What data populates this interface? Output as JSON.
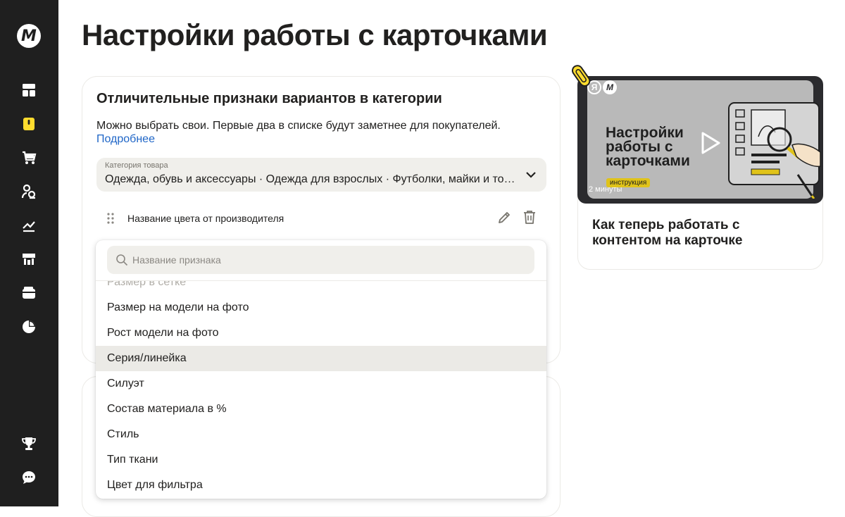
{
  "sidebar": {
    "logo_letter": "M",
    "items": [
      {
        "icon": "dashboard-icon"
      },
      {
        "icon": "card-icon",
        "active": true
      },
      {
        "icon": "cart-icon"
      },
      {
        "icon": "users-icon"
      },
      {
        "icon": "growth-icon"
      },
      {
        "icon": "store-icon"
      },
      {
        "icon": "wallet-icon"
      },
      {
        "icon": "pie-chart-icon"
      },
      {
        "icon": "trophy-icon"
      },
      {
        "icon": "chat-icon"
      }
    ],
    "accent": "#ffdc2e"
  },
  "page": {
    "title": "Настройки работы с карточками"
  },
  "variants_card": {
    "title": "Отличительные признаки вариантов в категории",
    "description": "Можно выбрать свои. Первые два в списке будут заметнее для покупателей.",
    "link": "Подробнее",
    "category_label": "Категория товара",
    "category_value": "Одежда, обувь и аксессуары · Одежда для взрослых · Футболки, майки и топы",
    "attribute": "Название цвета от производителя"
  },
  "dropdown": {
    "search_placeholder": "Название признака",
    "partial_item": "Размер в сетке",
    "items": [
      "Размер на модели на фото",
      "Рост модели на фото",
      "Серия/линейка",
      "Силуэт",
      "Состав материала в %",
      "Стиль",
      "Тип ткани",
      "Цвет для фильтра"
    ],
    "highlighted_item": "Серия/линейка"
  },
  "promo": {
    "video_heading": "Настройки работы с карточками",
    "video_tag": "инструкция",
    "video_duration": "2 минуты",
    "ya_letter": "Я",
    "m_letter": "M",
    "text": "Как теперь работать с контентом на карточке"
  }
}
